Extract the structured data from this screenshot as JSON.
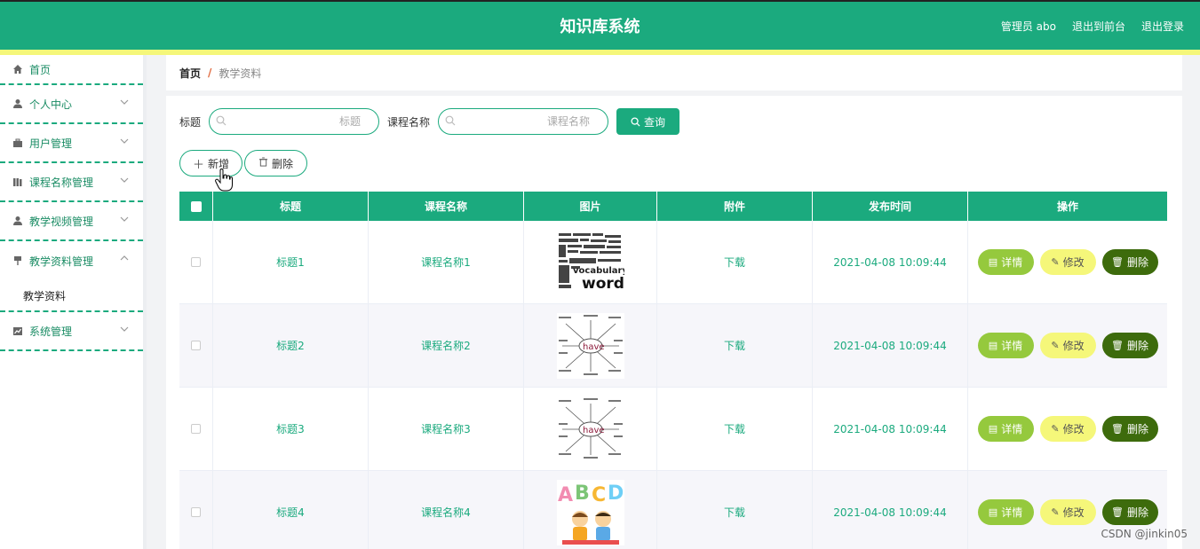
{
  "header": {
    "title": "知识库系统",
    "nav": [
      "管理员 abo",
      "退出到前台",
      "退出登录"
    ],
    "color": "#1baa7e",
    "accent_bar": "#f5f77a"
  },
  "sidebar": {
    "items": [
      {
        "label": "首页",
        "icon": "home-icon",
        "has_chevron": false
      },
      {
        "label": "个人中心",
        "icon": "user-icon",
        "has_chevron": true
      },
      {
        "label": "用户管理",
        "icon": "briefcase-icon",
        "has_chevron": true
      },
      {
        "label": "课程名称管理",
        "icon": "books-icon",
        "has_chevron": true
      },
      {
        "label": "教学视频管理",
        "icon": "user-icon",
        "has_chevron": true
      },
      {
        "label": "教学资料管理",
        "icon": "pin-icon",
        "has_chevron": true,
        "expanded": true,
        "children": [
          "教学资料"
        ]
      },
      {
        "label": "系统管理",
        "icon": "chart-icon",
        "has_chevron": true
      }
    ]
  },
  "breadcrumb": {
    "home": "首页",
    "separator": "/",
    "current": "教学资料"
  },
  "search": {
    "fields": [
      {
        "label": "标题",
        "placeholder": "标题"
      },
      {
        "label": "课程名称",
        "placeholder": "课程名称"
      }
    ],
    "query_label": "查询"
  },
  "actions": {
    "add_label": "新增",
    "delete_label": "删除"
  },
  "table": {
    "columns": [
      "标题",
      "课程名称",
      "图片",
      "附件",
      "发布时间",
      "操作"
    ],
    "rows": [
      {
        "title": "标题1",
        "course": "课程名称1",
        "image": "vocabulary-words",
        "attachment": "下载",
        "time": "2021-04-08 10:09:44"
      },
      {
        "title": "标题2",
        "course": "课程名称2",
        "image": "have-mindmap",
        "attachment": "下载",
        "time": "2021-04-08 10:09:44"
      },
      {
        "title": "标题3",
        "course": "课程名称3",
        "image": "have-mindmap",
        "attachment": "下载",
        "time": "2021-04-08 10:09:44"
      },
      {
        "title": "标题4",
        "course": "课程名称4",
        "image": "abcd-kids",
        "attachment": "下载",
        "time": "2021-04-08 10:09:44"
      }
    ],
    "row_actions": {
      "detail": "详情",
      "edit": "修改",
      "remove": "删除"
    }
  },
  "watermark": "CSDN @jinkin05"
}
